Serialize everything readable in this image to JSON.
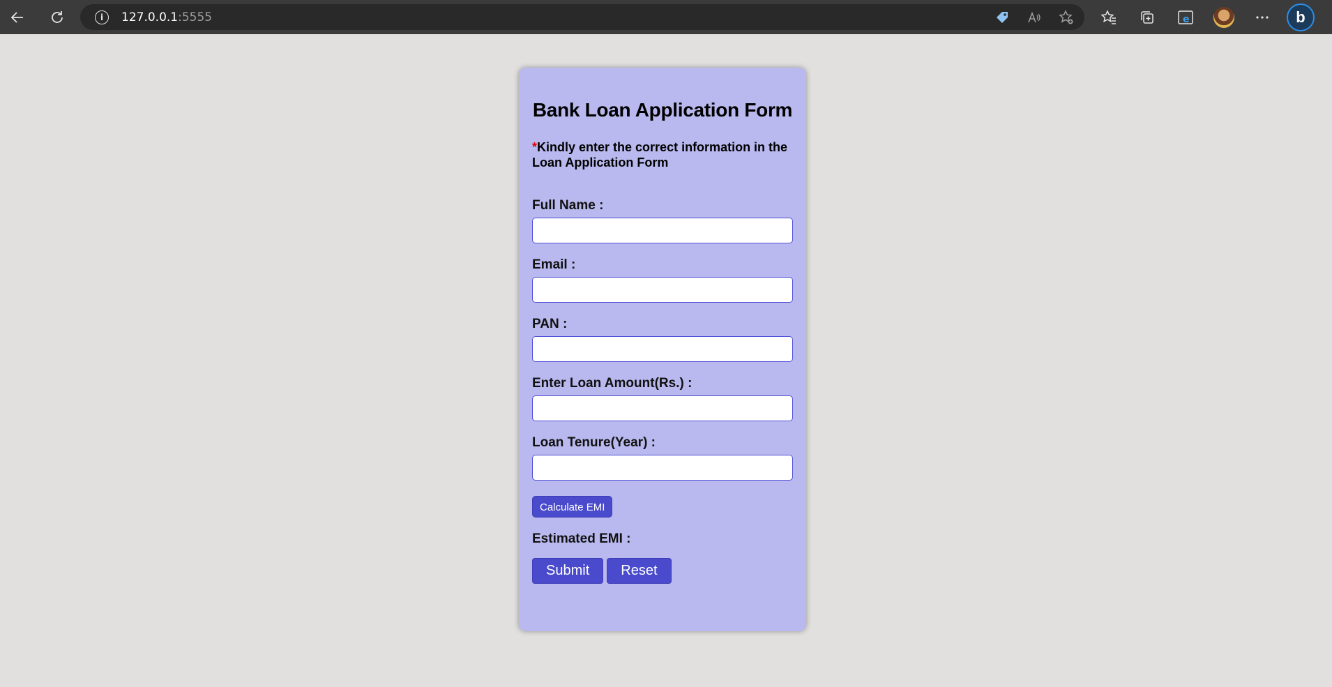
{
  "browser": {
    "url_host": "127.0.0.1",
    "url_port": ":5555",
    "icons": [
      "back-icon",
      "reload-icon",
      "info-icon",
      "tag-icon",
      "read-aloud-icon",
      "add-favorite-icon",
      "favorites-icon",
      "collections-icon",
      "edge-icon",
      "profile-avatar",
      "more-icon",
      "bing-icon"
    ]
  },
  "form": {
    "title": "Bank Loan Application Form",
    "note_star": "*",
    "note": "Kindly enter the correct information in the Loan Application Form",
    "fields": [
      {
        "label": "Full Name :",
        "value": ""
      },
      {
        "label": "Email :",
        "value": ""
      },
      {
        "label": "PAN :",
        "value": ""
      },
      {
        "label": "Enter Loan Amount(Rs.) :",
        "value": ""
      },
      {
        "label": "Loan Tenure(Year) :",
        "value": ""
      }
    ],
    "calculate_label": "Calculate EMI",
    "emi_label": "Estimated EMI :",
    "submit_label": "Submit",
    "reset_label": "Reset"
  },
  "colors": {
    "card_bg": "#b9b9ef",
    "accent": "#4a4acd",
    "page_bg": "#e1e0df",
    "required_star": "#e00000"
  }
}
